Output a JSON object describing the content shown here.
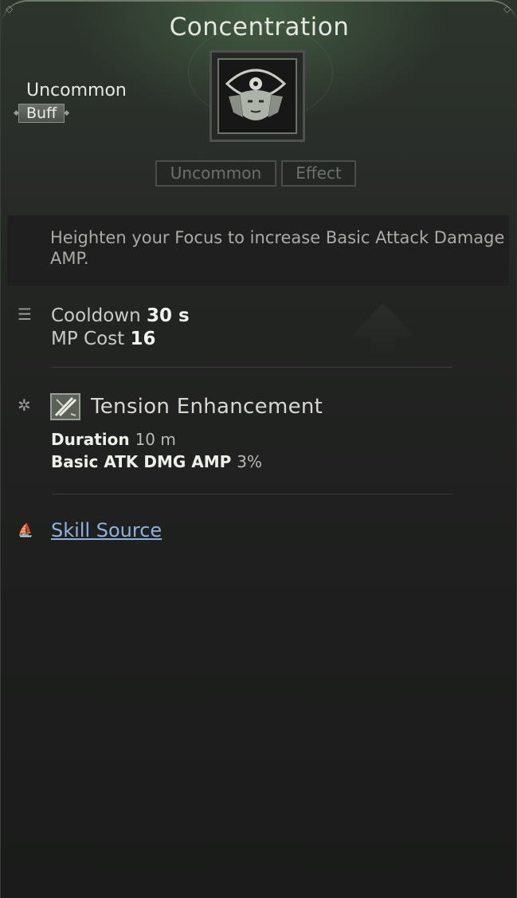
{
  "skill": {
    "title": "Concentration",
    "rarity": "Uncommon",
    "type_badge": "Buff",
    "icon": "eye-face-skill-icon"
  },
  "tags": [
    "Uncommon",
    "Effect"
  ],
  "description": "Heighten your Focus to increase Basic Attack Damage AMP.",
  "stats": {
    "cooldown_label": "Cooldown",
    "cooldown_value": "30 s",
    "mp_cost_label": "MP Cost",
    "mp_cost_value": "16"
  },
  "effect": {
    "name": "Tension Enhancement",
    "icon": "crossed-swords-icon",
    "duration_label": "Duration",
    "duration_value": "10 m",
    "amp_label": "Basic ATK DMG AMP",
    "amp_value": "3%"
  },
  "source_link": "Skill Source",
  "colors": {
    "background": "#1a1b1a",
    "header_glow": "#5c8a5c",
    "link": "#8fb0e0",
    "badge": "#5a5e58"
  }
}
